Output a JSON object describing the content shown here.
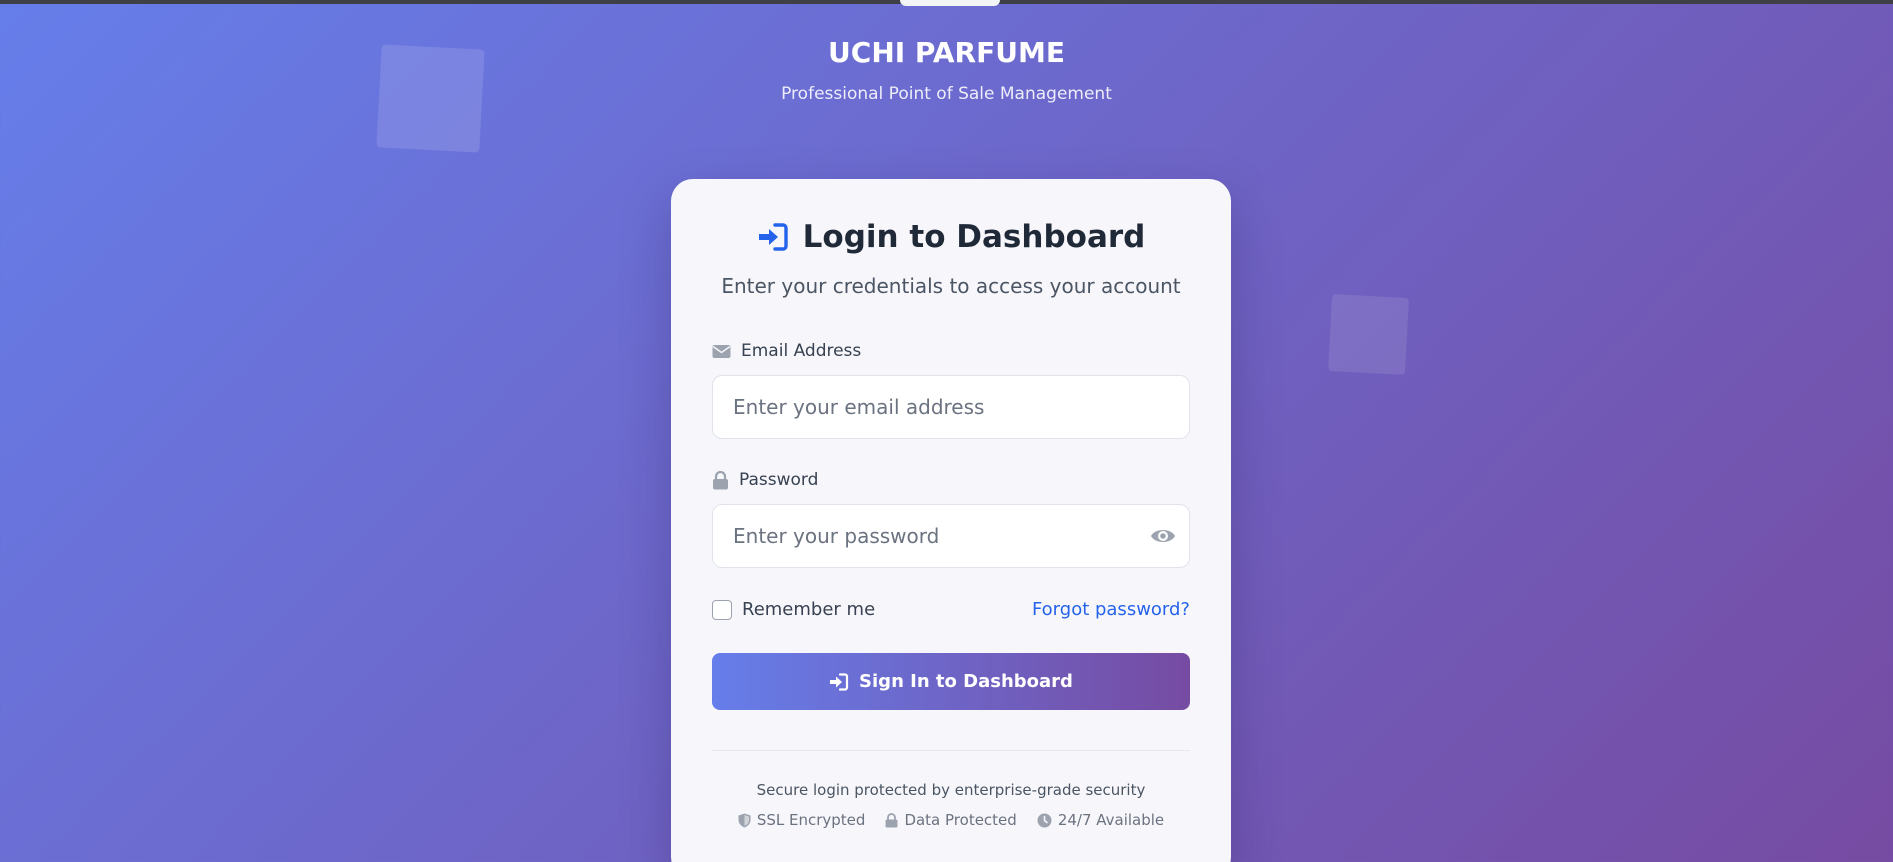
{
  "brand": {
    "title": "UCHI PARFUME",
    "subtitle": "Professional Point of Sale Management"
  },
  "login": {
    "title": "Login to Dashboard",
    "subtitle": "Enter your credentials to access your account",
    "email": {
      "label": "Email Address",
      "value": "",
      "placeholder": "Enter your email address",
      "icon": "envelope-icon"
    },
    "password": {
      "label": "Password",
      "value": "",
      "placeholder": "Enter your password",
      "icon": "lock-icon",
      "toggle_icon": "eye-icon"
    },
    "remember_label": "Remember me",
    "remember_checked": false,
    "forgot_label": "Forgot password?",
    "submit_label": "Sign In to Dashboard"
  },
  "footer": {
    "secure_text": "Secure login protected by enterprise-grade security",
    "badges": [
      {
        "icon": "shield-icon",
        "label": "SSL Encrypted"
      },
      {
        "icon": "lock-icon",
        "label": "Data Protected"
      },
      {
        "icon": "clock-icon",
        "label": "24/7 Available"
      }
    ]
  },
  "colors": {
    "accent": "#2563eb",
    "gradient_start": "#667eea",
    "gradient_end": "#764ba2",
    "card_bg": "#f7f7fb"
  }
}
